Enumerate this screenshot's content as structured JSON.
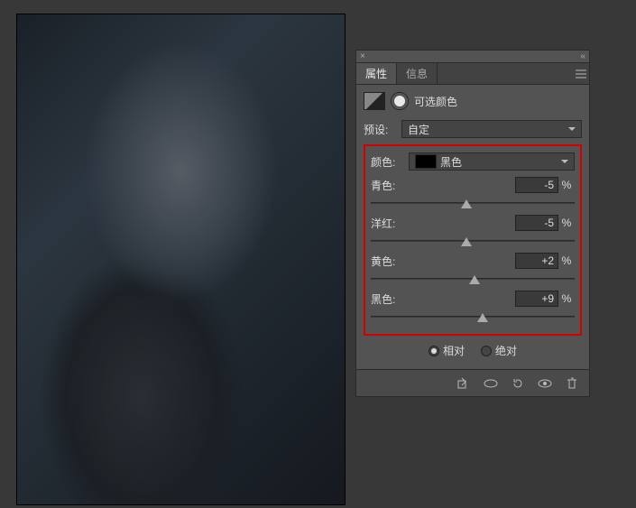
{
  "tabs": {
    "properties": "属性",
    "info": "信息"
  },
  "title": "可选颜色",
  "preset": {
    "label": "预设:",
    "value": "自定"
  },
  "color": {
    "label": "颜色:",
    "value": "黑色"
  },
  "sliders": {
    "cyan": {
      "label": "青色:",
      "value": "-5",
      "unit": "%",
      "pos": 47
    },
    "magenta": {
      "label": "洋红:",
      "value": "-5",
      "unit": "%",
      "pos": 47
    },
    "yellow": {
      "label": "黄色:",
      "value": "+2",
      "unit": "%",
      "pos": 51
    },
    "black": {
      "label": "黑色:",
      "value": "+9",
      "unit": "%",
      "pos": 55
    }
  },
  "method": {
    "relative": "相对",
    "absolute": "绝对",
    "selected": "relative"
  },
  "header_close": "×",
  "header_collapse": "«"
}
